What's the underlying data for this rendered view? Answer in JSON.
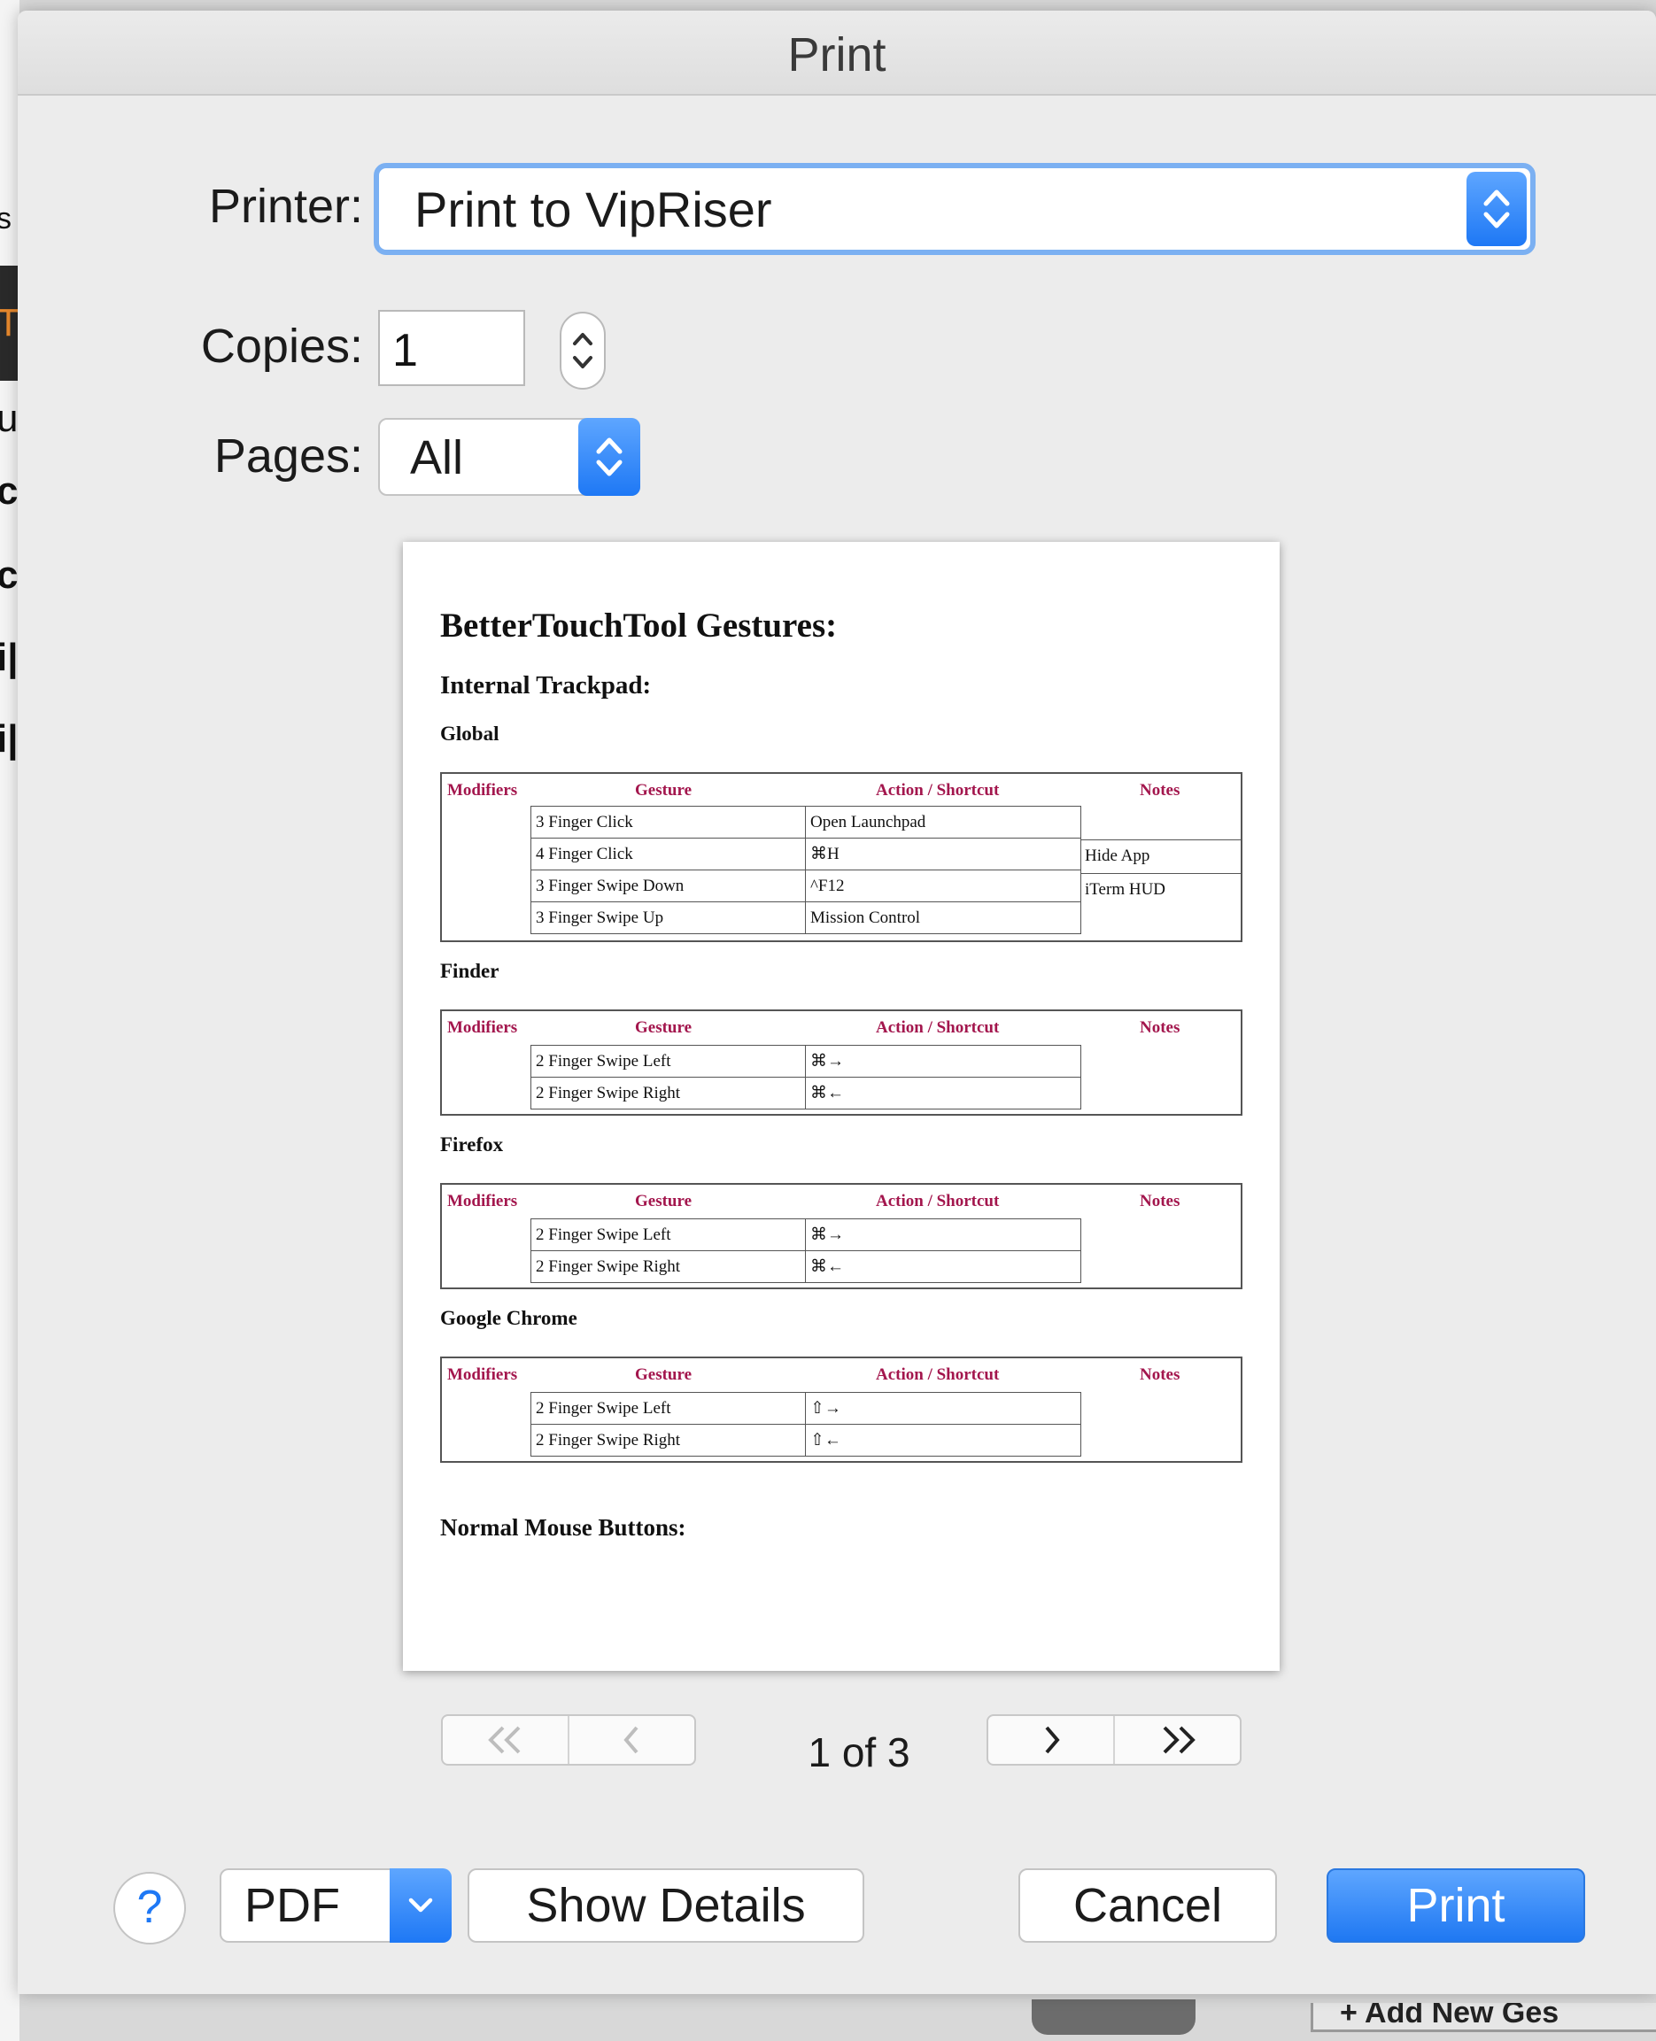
{
  "background": {
    "fragments": [
      "s",
      "Tı",
      "ur",
      "c",
      "c",
      "i|",
      "i|"
    ],
    "bottom_partial_text": "+ Add New Ges"
  },
  "dialog": {
    "title": "Print",
    "printer": {
      "label": "Printer:",
      "value": "Print to VipRiser"
    },
    "copies": {
      "label": "Copies:",
      "value": "1"
    },
    "pages": {
      "label": "Pages:",
      "value": "All"
    }
  },
  "preview": {
    "title": "BetterTouchTool Gestures:",
    "subtitle": "Internal Trackpad:",
    "headers": {
      "modifiers": "Modifiers",
      "gesture": "Gesture",
      "action": "Action / Shortcut",
      "notes": "Notes"
    },
    "sections": [
      {
        "name": "Global",
        "rows": [
          {
            "gesture": "3 Finger Click",
            "action": "Open Launchpad",
            "notes": ""
          },
          {
            "gesture": "4 Finger Click",
            "action": "⌘H",
            "notes": "Hide App"
          },
          {
            "gesture": "3 Finger Swipe Down",
            "action": "^F12",
            "notes": "iTerm HUD"
          },
          {
            "gesture": "3 Finger Swipe Up",
            "action": "Mission Control",
            "notes": ""
          }
        ]
      },
      {
        "name": "Finder",
        "rows": [
          {
            "gesture": "2 Finger Swipe Left",
            "action": "⌘→"
          },
          {
            "gesture": "2 Finger Swipe Right",
            "action": "⌘←"
          }
        ]
      },
      {
        "name": "Firefox",
        "rows": [
          {
            "gesture": "2 Finger Swipe Left",
            "action": "⌘→"
          },
          {
            "gesture": "2 Finger Swipe Right",
            "action": "⌘←"
          }
        ]
      },
      {
        "name": "Google Chrome",
        "rows": [
          {
            "gesture": "2 Finger Swipe Left",
            "action": "⇧→"
          },
          {
            "gesture": "2 Finger Swipe Right",
            "action": "⇧←"
          }
        ]
      }
    ],
    "footer_heading": "Normal Mouse Buttons:"
  },
  "pagination": {
    "current": "1 of 3"
  },
  "buttons": {
    "help": "?",
    "pdf": "PDF",
    "show_details": "Show Details",
    "cancel": "Cancel",
    "print": "Print"
  },
  "colors": {
    "accent": "#1e78f5",
    "table_header": "#a3164d"
  }
}
